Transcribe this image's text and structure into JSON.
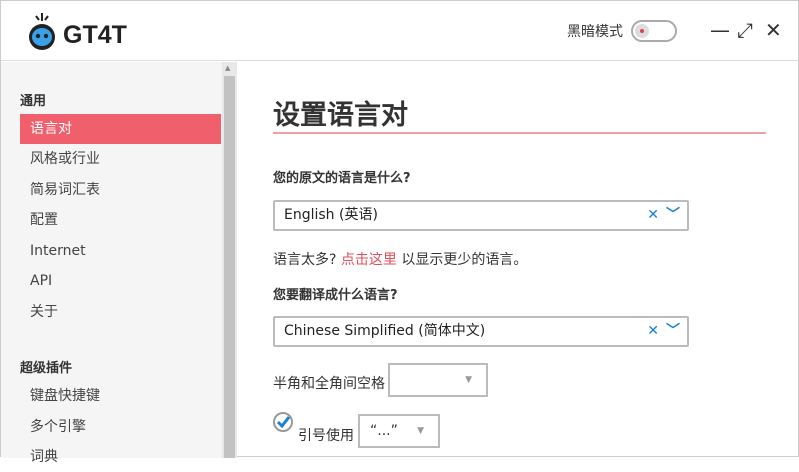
{
  "app": {
    "name": "GT4T",
    "dark_mode_label": "黑暗模式",
    "dark_mode_on": false
  },
  "window": {
    "minimize": "—",
    "maximize": "⤢",
    "close": "✕"
  },
  "sidebar": {
    "sections": [
      {
        "label": "通用"
      },
      {
        "label": "超级插件"
      }
    ],
    "items": [
      {
        "label": "语言对"
      },
      {
        "label": "风格或行业"
      },
      {
        "label": "简易词汇表"
      },
      {
        "label": "配置"
      },
      {
        "label": "Internet"
      },
      {
        "label": "API"
      },
      {
        "label": "关于"
      },
      {
        "label": "键盘快捷键"
      },
      {
        "label": "多个引擎"
      },
      {
        "label": "词典"
      }
    ]
  },
  "main": {
    "title": "设置语言对",
    "source_question": "您的原文的语言是什么?",
    "source_value": "English (英语)",
    "note_prefix": "语言太多? ",
    "note_link": "点击这里",
    "note_suffix": " 以显示更少的语言。",
    "target_question": "您要翻译成什么语言?",
    "target_value": "Chinese Simplified (简体中文)",
    "spacing_label": "半角和全角间空格",
    "spacing_value": "",
    "quote_label": "引号使用",
    "quote_value": "“...”",
    "quote_checked": true,
    "clear_icon": "✕",
    "dropdown_icon": "﹀"
  },
  "colors": {
    "accent": "#f0606c",
    "link": "#e0505c",
    "select_icon": "#1a7fd4"
  }
}
